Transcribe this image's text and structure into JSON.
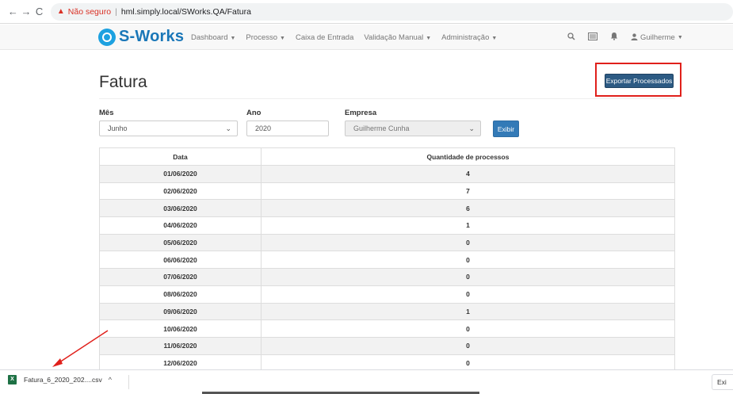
{
  "browser": {
    "back_icon": "←",
    "forward_icon": "→",
    "reload_icon": "C",
    "warning_icon": "▲",
    "security_text": "Não seguro",
    "separator": "|",
    "url": "hml.simply.local/SWorks.QA/Fatura"
  },
  "nav": {
    "brand": "S-Works",
    "brand_color": "#1a77b8",
    "menu": [
      {
        "label": "Dashboard",
        "caret": "▼"
      },
      {
        "label": "Processo",
        "caret": "▼"
      },
      {
        "label": "Caixa de Entrada",
        "caret": ""
      },
      {
        "label": "Validação Manual",
        "caret": "▼"
      },
      {
        "label": "Administração",
        "caret": "▼"
      }
    ],
    "search_icon": "🔍",
    "inbox_icon": "▤",
    "bell_icon": "🔔",
    "user_icon": "👤",
    "user_name": "Guilherme",
    "user_caret": "▼"
  },
  "page": {
    "title": "Fatura",
    "export_label": "Exportar Processados",
    "highlight_color": "#e0201b"
  },
  "form": {
    "mes_label": "Mês",
    "mes_value": "Junho",
    "ano_label": "Ano",
    "ano_value": "2020",
    "empresa_label": "Empresa",
    "empresa_value": "Guilherme Cunha",
    "select_caret": "⌄",
    "exibir_label": "Exibir"
  },
  "table": {
    "headers": [
      "Data",
      "Quantidade de processos"
    ],
    "rows": [
      [
        "01/06/2020",
        "4"
      ],
      [
        "02/06/2020",
        "7"
      ],
      [
        "03/06/2020",
        "6"
      ],
      [
        "04/06/2020",
        "1"
      ],
      [
        "05/06/2020",
        "0"
      ],
      [
        "06/06/2020",
        "0"
      ],
      [
        "07/06/2020",
        "0"
      ],
      [
        "08/06/2020",
        "0"
      ],
      [
        "09/06/2020",
        "1"
      ],
      [
        "10/06/2020",
        "0"
      ],
      [
        "11/06/2020",
        "0"
      ],
      [
        "12/06/2020",
        "0"
      ]
    ]
  },
  "download": {
    "file_icon_letter": "X",
    "file_name": "Fatura_6_2020_202....csv",
    "caret": "^",
    "exit_label": "Exi"
  }
}
